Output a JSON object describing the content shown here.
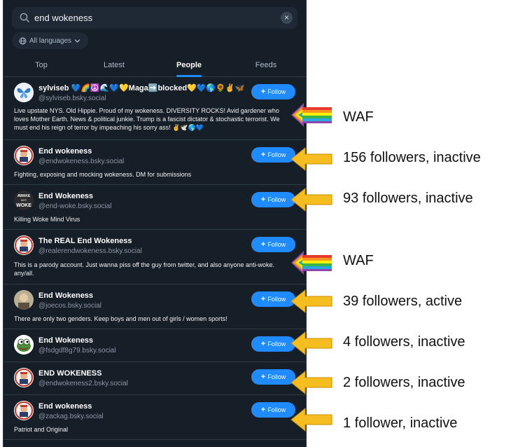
{
  "search": {
    "query": "end wokeness",
    "clear_label": "×"
  },
  "language": {
    "label": "All languages"
  },
  "tabs": [
    {
      "label": "Top"
    },
    {
      "label": "Latest"
    },
    {
      "label": "People"
    },
    {
      "label": "Feeds"
    }
  ],
  "follow_label": "Follow",
  "accounts": [
    {
      "name": "sylviseb 💙🌈☮️🌊💙💛Maga➡️blocked💛💙🌎🌻✌️🦋",
      "handle": "@sylviseb.bsky.social",
      "bio": "Live upstate NYS. Old Hippie. Proud of my wokeness. DIVERSITY ROCKS! Avid gardener who loves Mother Earth. News & political junkie. Trump is a fascist dictator & stochastic terrorist. We must end his reign of terror by impeaching his sorry ass! ✌️🕊️🌎💙"
    },
    {
      "name": "End wokeness",
      "handle": "@endwokeness.bsky.social",
      "bio": "Fighting, exposing and mocking wokeness. DM for submissions"
    },
    {
      "name": "End Wokeness",
      "handle": "@end-woke.bsky.social",
      "bio": "Killing Woke Mind Virus",
      "avatar_text": [
        "AWAKE",
        "NOT",
        "WOKE"
      ]
    },
    {
      "name": "The REAL End Wokeness",
      "handle": "@realerendwokeness.bsky.social",
      "bio": "This is a parody account. Just wanna piss off the guy from twitter, and also anyone anti-woke. any/all."
    },
    {
      "name": "End Wokeness",
      "handle": "@joecos.bsky.social",
      "bio": "There are only two genders.  Keep boys and men out of girls / women sports!"
    },
    {
      "name": "End Wokeness",
      "handle": "@fsdgdf8g79.bsky.social",
      "bio": ""
    },
    {
      "name": "END WOKENESS",
      "handle": "@endwokeness2.bsky.social",
      "bio": ""
    },
    {
      "name": "End wokeness",
      "handle": "@zackag.bsky.social",
      "bio": "Patriot and Original"
    }
  ],
  "annotations": [
    {
      "text": "WAF",
      "arrow": "rainbow"
    },
    {
      "text": "156 followers, inactive",
      "arrow": "yellow"
    },
    {
      "text": "93 followers, inactive",
      "arrow": "yellow"
    },
    {
      "text": "WAF",
      "arrow": "rainbow"
    },
    {
      "text": "39 followers, active",
      "arrow": "yellow"
    },
    {
      "text": "4 followers, inactive",
      "arrow": "yellow"
    },
    {
      "text": "2 followers, inactive",
      "arrow": "yellow"
    },
    {
      "text": "1 follower, inactive",
      "arrow": "yellow"
    }
  ],
  "colors": {
    "background": "#161e27",
    "accent": "#208bfe",
    "arrow_yellow": "#f5bd1f",
    "rainbow": [
      "#e63a2e",
      "#f7941d",
      "#fff200",
      "#39b54a",
      "#27aae1",
      "#8e44ad"
    ]
  }
}
